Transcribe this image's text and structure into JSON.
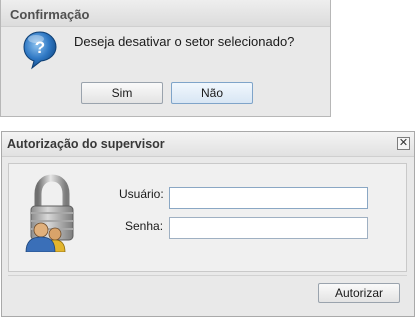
{
  "confirm_dialog": {
    "title": "Confirmação",
    "icon": "question-icon",
    "message": "Deseja desativar o setor selecionado?",
    "yes_label": "Sim",
    "no_label": "Não"
  },
  "auth_dialog": {
    "title": "Autorização do supervisor",
    "close_glyph": "✕",
    "icon": "lock-users-icon",
    "username_label": "Usuário:",
    "username_value": "",
    "password_label": "Senha:",
    "password_value": "",
    "authorize_label": "Autorizar"
  }
}
